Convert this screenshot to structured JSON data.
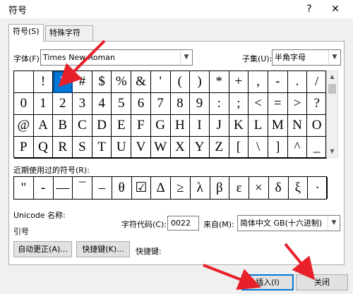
{
  "window": {
    "title": "符号",
    "help_label": "?",
    "close_label": "✕"
  },
  "tabs": [
    {
      "label": "符号(S)"
    },
    {
      "label": "特殊字符(P)"
    }
  ],
  "font": {
    "label": "字体(F):",
    "value": "Times New Roman"
  },
  "subset": {
    "label": "子集(U):",
    "value": "半角字母"
  },
  "grid": {
    "rows": [
      [
        "",
        "!",
        "\"",
        "#",
        "$",
        "%",
        "&",
        "'",
        "(",
        ")",
        "*",
        "+",
        ",",
        "-",
        ".",
        "/"
      ],
      [
        "0",
        "1",
        "2",
        "3",
        "4",
        "5",
        "6",
        "7",
        "8",
        "9",
        ":",
        ";",
        "<",
        "=",
        ">",
        "?"
      ],
      [
        "@",
        "A",
        "B",
        "C",
        "D",
        "E",
        "F",
        "G",
        "H",
        "I",
        "J",
        "K",
        "L",
        "M",
        "N",
        "O"
      ],
      [
        "P",
        "Q",
        "R",
        "S",
        "T",
        "U",
        "V",
        "W",
        "X",
        "Y",
        "Z",
        "[",
        "\\",
        "]",
        "^",
        "_"
      ]
    ],
    "selected": "\""
  },
  "recent": {
    "label": "近期使用过的符号(R):",
    "symbols": [
      "\"",
      "-",
      "—",
      "¯",
      "–",
      "θ",
      "☑",
      "Δ",
      "≥",
      "λ",
      "β",
      "ε",
      "×",
      "δ",
      "ξ",
      "·"
    ]
  },
  "unicode": {
    "label": "Unicode 名称:",
    "name": "引号"
  },
  "charcode": {
    "label": "字符代码(C):",
    "value": "0022"
  },
  "from": {
    "label": "来自(M):",
    "value": "简体中文 GB(十六进制)"
  },
  "buttons": {
    "autocorrect": "自动更正(A)...",
    "shortcut_key": "快捷键(K)...",
    "shortcut_label": "快捷键:",
    "insert": "插入(I)",
    "close": "关闭"
  },
  "colors": {
    "accent": "#0078d7",
    "annotation": "#e8202a"
  }
}
